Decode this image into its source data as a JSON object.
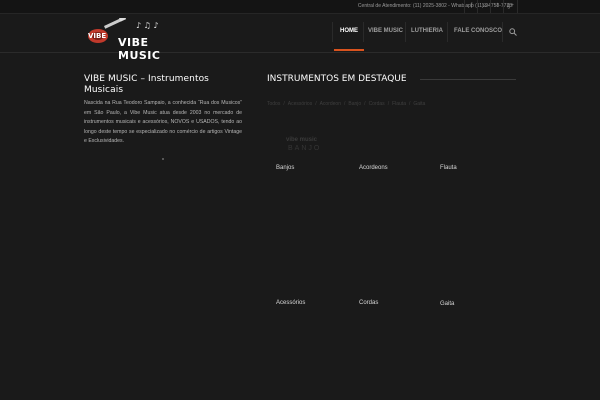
{
  "topbar": {
    "contact": "Central de Atendimento: (11) 2025-3802 - Whatsapp (11)-94758-7733",
    "social": [
      {
        "icon": "facebook-icon",
        "glyph": "f"
      },
      {
        "icon": "instagram-icon",
        "glyph": "◘"
      },
      {
        "icon": "twitter-icon",
        "glyph": "t"
      },
      {
        "icon": "google-plus-icon",
        "glyph": "g+"
      }
    ]
  },
  "header": {
    "logo_text": "VIBE MUSIC",
    "logo_badge": "VIBE"
  },
  "nav": {
    "items": [
      "HOME",
      "VIBE MUSIC",
      "LUTHIERIA",
      "FALE CONOSCO"
    ],
    "active": "HOME",
    "accent": "#d9531e"
  },
  "left": {
    "title": "VIBE MUSIC – Instrumentos Musicais",
    "text": "Nascida na Rua Teodoro Sampaio, a conhecida “Rua dos Musicos” em São Paulo, a Vibe Music atua desde 2003 no mercado de instrumentos musicais e acessórios, NOVOS e USADOS, tendo ao longo deste tempo se especializado no comércio de artigos Vintage e Exclusividades."
  },
  "right": {
    "title": "INSTRUMENTOS EM DESTAQUE",
    "filters": [
      "Todos",
      "/",
      "Acessórios",
      "/",
      "Acordeon",
      "/",
      "Banjo",
      "/",
      "Cordas",
      "/",
      "Flauta",
      "/",
      "Gaita"
    ],
    "tiles": [
      {
        "label": "Banjos",
        "thumb_brand": "vibe music",
        "thumb_sub": "BANJO"
      },
      {
        "label": "Acordeons"
      },
      {
        "label": "Flauta"
      },
      {
        "label": "Acessórios"
      },
      {
        "label": "Cordas"
      },
      {
        "label": "Gaita"
      }
    ]
  }
}
